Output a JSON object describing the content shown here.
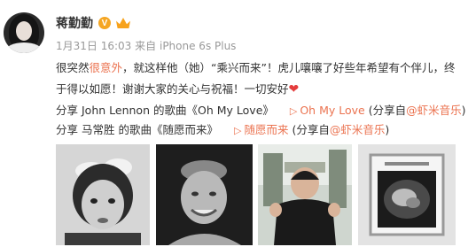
{
  "user": {
    "name": "蒋勤勤",
    "verified_badge": "V"
  },
  "meta": {
    "time": "1月31日 16:03",
    "source_prefix": "来自",
    "source": "iPhone 6s Plus"
  },
  "post": {
    "line1_a": "很突然",
    "line1_highlight": "很意外",
    "line1_b": "，就这样他（她）“乘兴而来”！虎儿嚷嚷了好些年希望有个伴儿，终",
    "line2": "于得以如愿！谢谢大家的关心与祝福！一切安好",
    "heart": "❤"
  },
  "shares": [
    {
      "prefix": "分享",
      "artist": "John Lennon",
      "middle": "的歌曲",
      "song_title": "《Oh My Love》",
      "play_icon": "▷",
      "link_text": "Oh My Love",
      "via_prefix": "(分享自",
      "via_link": "@虾米音乐",
      "via_suffix": ")"
    },
    {
      "prefix": "分享",
      "artist": "马常胜",
      "middle": "的歌曲",
      "song_title": "《随愿而来》",
      "play_icon": "▷",
      "link_text": "随愿而来",
      "via_prefix": "(分享自",
      "via_link": "@虾米音乐",
      "via_suffix": ")"
    }
  ],
  "photos": [
    {
      "description": "black-and-white childhood portrait of a girl"
    },
    {
      "description": "black-and-white portrait of a smiling boy in a cap"
    },
    {
      "description": "color photo of a boy in a black jacket outdoors"
    },
    {
      "description": "framed ultrasound scan image"
    }
  ],
  "colors": {
    "accent": "#eb7350",
    "text": "#333333",
    "meta": "#999999",
    "badge": "#f5a623",
    "heart": "#e43c3c"
  }
}
